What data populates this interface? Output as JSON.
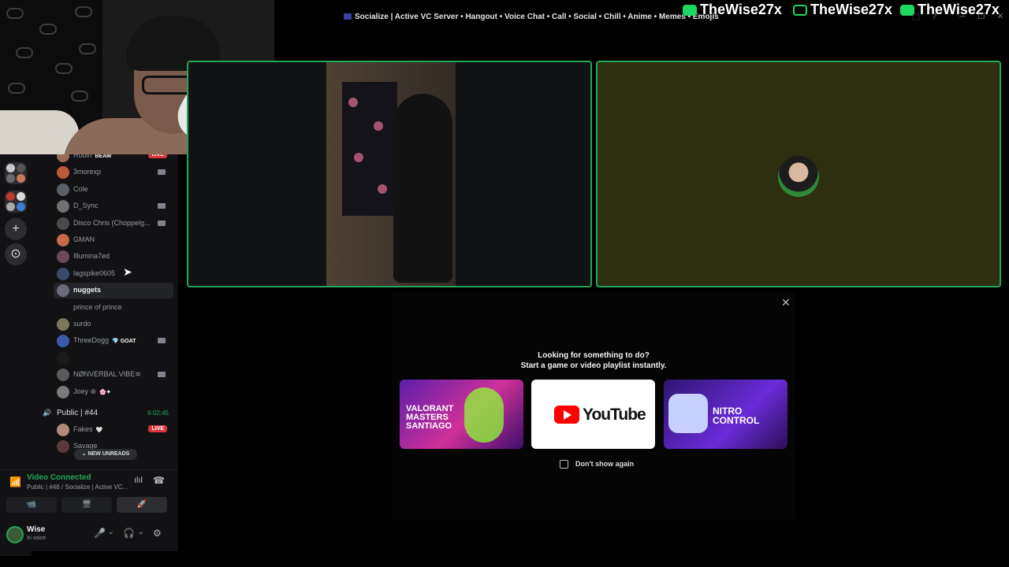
{
  "titlebar": {
    "server_title": "Socialize | Active VC Server • Hangout • Voice Chat • Call • Social • Chill • Anime • Memes • Emojis",
    "overlay_names": [
      "TheWise27x",
      "TheWise27x",
      "TheWise27x"
    ],
    "window_buttons": [
      "⬚",
      "?",
      "─",
      "☐",
      "✕"
    ]
  },
  "rail": {
    "add_server": "+",
    "explore": "⊙"
  },
  "sidebar": {
    "members_top": [
      {
        "name": "Robin",
        "tag": "BEAM",
        "live": "LIVE",
        "color": "#9b6b5a"
      },
      {
        "name": "3morexp",
        "color": "#c0583a",
        "cam": true
      },
      {
        "name": "Cole",
        "color": "#5a5e66"
      },
      {
        "name": "D_Sync",
        "color": "#707070",
        "cam": true
      },
      {
        "name": "Disco Chris (Choppelg...",
        "color": "#4a4a4a",
        "cam": true
      },
      {
        "name": "GMAN",
        "color": "#c56a4a"
      },
      {
        "name": "Illumina7ed",
        "color": "#6a4a5a"
      },
      {
        "name": "lagspike0605",
        "color": "#3a4a6a"
      },
      {
        "name": "nuggets",
        "color": "#6a6a7a",
        "active": true
      },
      {
        "name": "prince of prince",
        "color": "#121214"
      },
      {
        "name": "surdo",
        "color": "#7a7a5a"
      },
      {
        "name": "ThreeDogg",
        "tag": "💎 GOAT",
        "color": "#3a5aa8",
        "cam": true
      },
      {
        "name": "",
        "color": "#1a1a1a"
      },
      {
        "name": "NØNVERBAL VIBE≋",
        "color": "#5a5a5a",
        "cam": true
      },
      {
        "name": "Joey ⊛",
        "tag": "🌸✦",
        "color": "#7a7a7a"
      }
    ],
    "voice_channel": {
      "name": "Public | #44",
      "time": "6:02:45",
      "speaker_icon": "🔊"
    },
    "members_bottom": [
      {
        "name": "Fakes",
        "tag": "🤍",
        "live": "LIVE",
        "color": "#b08a7a"
      },
      {
        "name": "Savage",
        "color": "#5a3a3a"
      }
    ],
    "new_unreads": "⌄ NEW UNREADS"
  },
  "voice_panel": {
    "status": "Video Connected",
    "channel": "Public | #46 / Socialize | Active VC...",
    "signal_icon": "📶",
    "noise_icon": "ılıl",
    "disconnect_icon": "☎",
    "actions": [
      "📹",
      "🖥",
      "🚀"
    ]
  },
  "user_panel": {
    "name": "Wise",
    "status": "In voice",
    "mic_icon": "🎤",
    "headset_icon": "🎧",
    "settings_icon": "⚙",
    "chevron": "⌄"
  },
  "activity": {
    "close": "✕",
    "title": "Looking for something to do?",
    "subtitle": "Start a game or video playlist instantly.",
    "cards": {
      "valorant": "VALORANT MASTERS SANTIAGO",
      "youtube": "YouTube",
      "nitro": "NITRO CONTROL"
    },
    "dont_show": "Don't show again"
  },
  "cursor": "➤"
}
